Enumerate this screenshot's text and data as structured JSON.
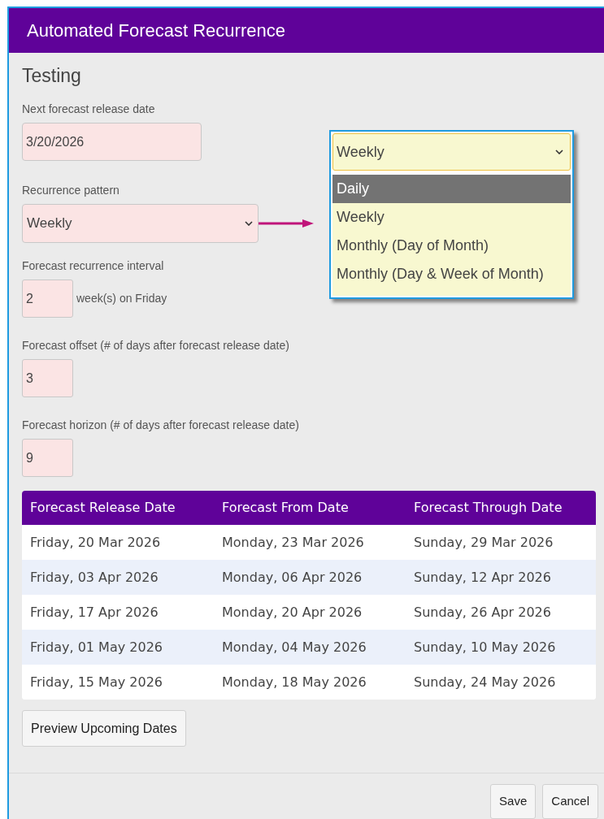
{
  "dialog": {
    "title": "Automated Forecast Recurrence"
  },
  "name": "Testing",
  "release_date": {
    "label": "Next forecast release date",
    "value": "3/20/2026"
  },
  "pattern": {
    "label": "Recurrence pattern",
    "value": "Weekly"
  },
  "interval": {
    "label": "Forecast recurrence interval",
    "value": "2",
    "suffix": "week(s) on Friday"
  },
  "offset": {
    "label": "Forecast offset (# of days after forecast release date)",
    "value": "3"
  },
  "horizon": {
    "label": "Forecast horizon (# of days after forecast release date)",
    "value": "9"
  },
  "callout": {
    "value": "Weekly",
    "options": [
      {
        "label": "Daily",
        "highlighted": true
      },
      {
        "label": "Weekly",
        "highlighted": false
      },
      {
        "label": "Monthly (Day of Month)",
        "highlighted": false
      },
      {
        "label": "Monthly (Day & Week of Month)",
        "highlighted": false
      }
    ]
  },
  "table": {
    "columns": [
      "Forecast Release Date",
      "Forecast From Date",
      "Forecast Through Date"
    ],
    "rows": [
      [
        "Friday, 20 Mar 2026",
        "Monday, 23 Mar 2026",
        "Sunday, 29 Mar 2026"
      ],
      [
        "Friday, 03 Apr 2026",
        "Monday, 06 Apr 2026",
        "Sunday, 12 Apr 2026"
      ],
      [
        "Friday, 17 Apr 2026",
        "Monday, 20 Apr 2026",
        "Sunday, 26 Apr 2026"
      ],
      [
        "Friday, 01 May 2026",
        "Monday, 04 May 2026",
        "Sunday, 10 May 2026"
      ],
      [
        "Friday, 15 May 2026",
        "Monday, 18 May 2026",
        "Sunday, 24 May 2026"
      ]
    ]
  },
  "preview_button": "Preview Upcoming Dates",
  "buttons": [
    "Save",
    "Cancel"
  ]
}
